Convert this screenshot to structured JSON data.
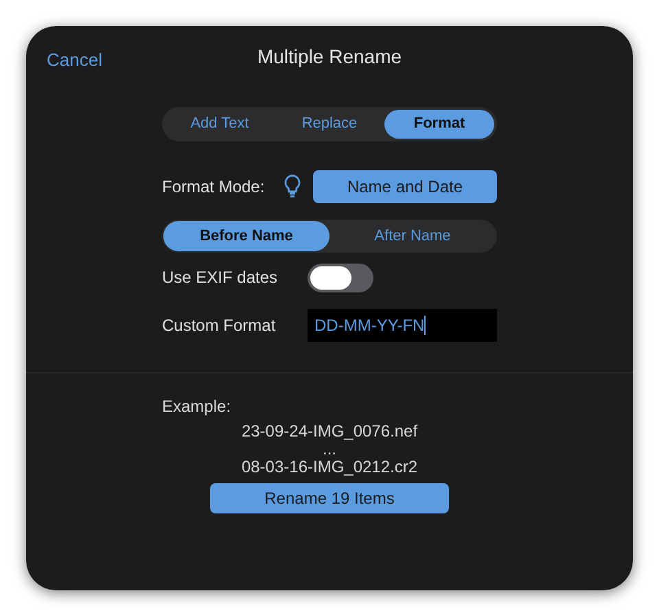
{
  "nav": {
    "cancel": "Cancel",
    "title": "Multiple Rename"
  },
  "tabs": [
    {
      "label": "Add Text",
      "selected": false
    },
    {
      "label": "Replace",
      "selected": false
    },
    {
      "label": "Format",
      "selected": true
    }
  ],
  "format_mode": {
    "label": "Format Mode:",
    "value": "Name and Date"
  },
  "position": [
    {
      "label": "Before Name",
      "selected": true
    },
    {
      "label": "After Name",
      "selected": false
    }
  ],
  "exif": {
    "label": "Use EXIF dates",
    "on": false
  },
  "custom_format": {
    "label": "Custom Format",
    "value": "DD-MM-YY-FN"
  },
  "example": {
    "label": "Example:",
    "lines": [
      "23-09-24-IMG_0076.nef",
      "...",
      "08-03-16-IMG_0212.cr2"
    ]
  },
  "rename_button": "Rename 19 Items"
}
